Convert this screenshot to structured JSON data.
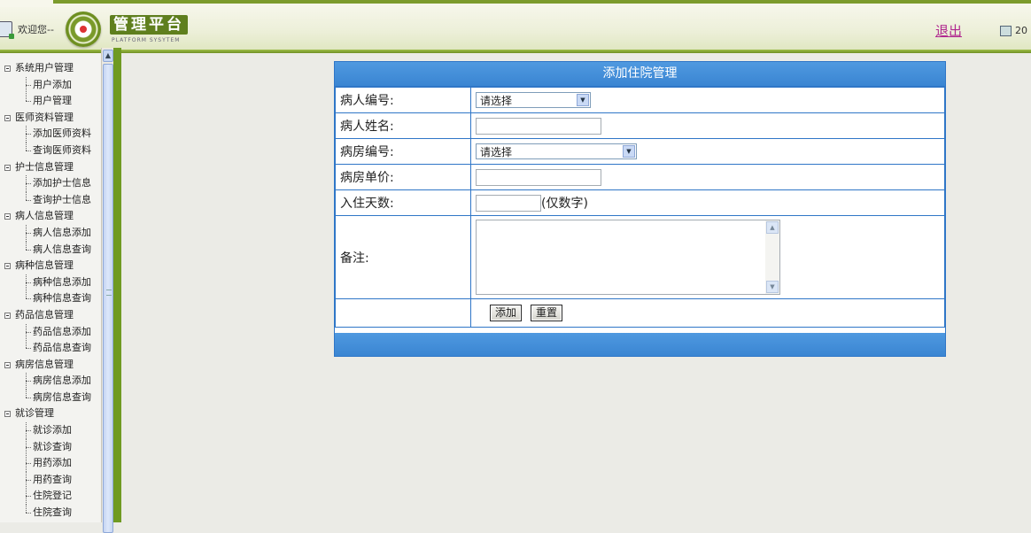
{
  "header": {
    "welcome": "欢迎您--",
    "logo_title": "管理平台",
    "logo_subtitle": "PLATFORM SYSYTEM",
    "logout": "退出",
    "date_fragment": "20"
  },
  "sidebar": {
    "groups": [
      {
        "label": "系统用户管理",
        "items": [
          "用户添加",
          "用户管理"
        ]
      },
      {
        "label": "医师资料管理",
        "items": [
          "添加医师资料",
          "查询医师资料"
        ]
      },
      {
        "label": "护士信息管理",
        "items": [
          "添加护士信息",
          "查询护士信息"
        ]
      },
      {
        "label": "病人信息管理",
        "items": [
          "病人信息添加",
          "病人信息查询"
        ]
      },
      {
        "label": "病种信息管理",
        "items": [
          "病种信息添加",
          "病种信息查询"
        ]
      },
      {
        "label": "药品信息管理",
        "items": [
          "药品信息添加",
          "药品信息查询"
        ]
      },
      {
        "label": "病房信息管理",
        "items": [
          "病房信息添加",
          "病房信息查询"
        ]
      },
      {
        "label": "就诊管理",
        "items": [
          "就诊添加",
          "就诊查询",
          "用药添加",
          "用药查询",
          "住院登记",
          "住院查询"
        ]
      }
    ]
  },
  "form": {
    "title": "添加住院管理",
    "patient_id_label": "病人编号:",
    "patient_id_value": "请选择",
    "patient_name_label": "病人姓名:",
    "patient_name_value": "",
    "ward_id_label": "病房编号:",
    "ward_id_value": "请选择",
    "ward_price_label": "病房单价:",
    "ward_price_value": "",
    "days_label": "入住天数:",
    "days_value": "",
    "days_hint": "(仅数字)",
    "note_label": "备注:",
    "note_value": "",
    "add_button": "添加",
    "reset_button": "重置"
  },
  "colors": {
    "header_green": "#7c9b2c",
    "panel_blue": "#3a85d2",
    "logout_link": "#b0278f"
  }
}
